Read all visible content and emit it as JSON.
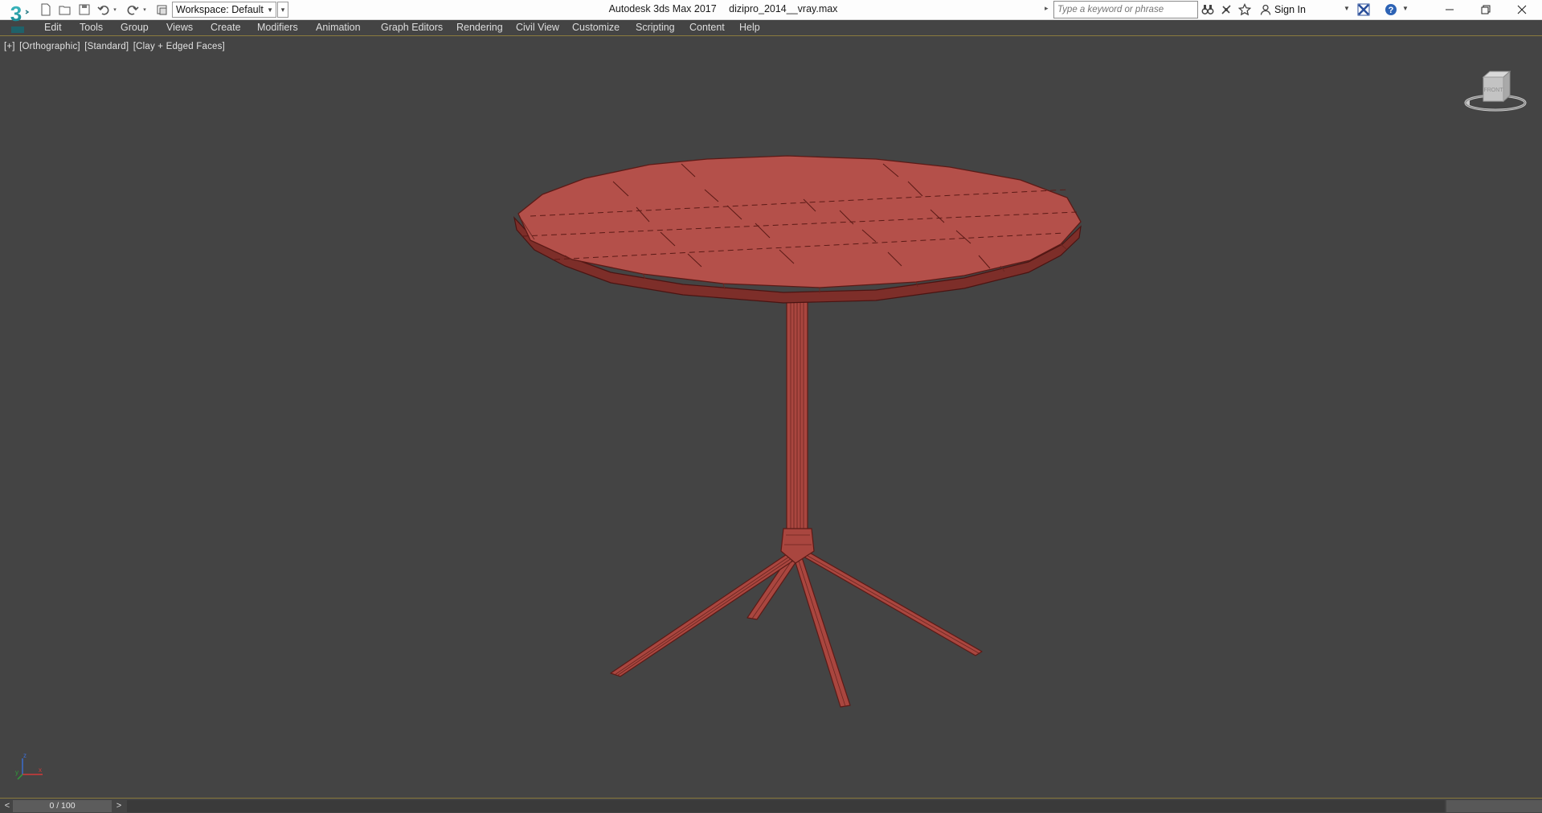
{
  "app": {
    "title": "Autodesk 3ds Max 2017",
    "filename": "dizipro_2014__vray.max",
    "logo_text": "3"
  },
  "quick_access": {
    "workspace_label": "Workspace: Default"
  },
  "search": {
    "placeholder": "Type a keyword or phrase"
  },
  "account": {
    "sign_in_label": "Sign In"
  },
  "menu": {
    "items": [
      "Edit",
      "Tools",
      "Group",
      "Views",
      "Create",
      "Modifiers",
      "Animation",
      "Graph Editors",
      "Rendering",
      "Civil View",
      "Customize",
      "Scripting",
      "Content",
      "Help"
    ]
  },
  "viewport": {
    "labels": [
      "[+]",
      "[Orthographic]",
      "[Standard]",
      "[Clay + Edged Faces]"
    ],
    "viewcube_face": "FRONT",
    "object_color": "#b4504a",
    "background_color": "#444444"
  },
  "axis": {
    "x": "x",
    "y": "y",
    "z": "z"
  },
  "time_slider": {
    "prev": "<",
    "position": "0 / 100",
    "next": ">"
  }
}
